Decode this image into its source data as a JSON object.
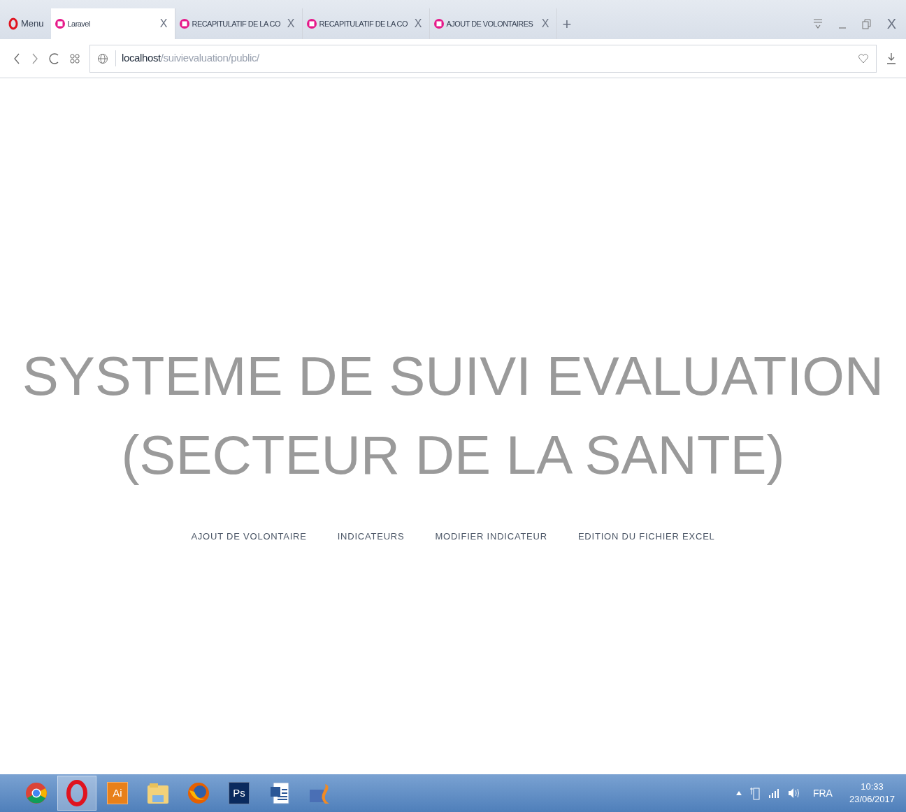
{
  "browser": {
    "menu_label": "Menu",
    "tabs": [
      {
        "label": "Laravel",
        "selected": true,
        "close": "X"
      },
      {
        "label": "RECAPITULATIF DE LA CO",
        "selected": false,
        "close": "X"
      },
      {
        "label": "RECAPITULATIF DE LA CO",
        "selected": false,
        "close": "X"
      },
      {
        "label": "AJOUT DE VOLONTAIRES",
        "selected": false,
        "close": "X"
      }
    ],
    "new_tab_glyph": "+",
    "window_close_glyph": "X",
    "address": {
      "host": "localhost",
      "path": "/suivievaluation/public/"
    }
  },
  "page": {
    "title_lines": [
      "SYSTEME DE SUIVI EVALUATION",
      "(SECTEUR DE LA SANTE)"
    ],
    "links": [
      "AJOUT DE VOLONTAIRE",
      "INDICATEURS",
      "MODIFIER INDICATEUR",
      "EDITION DU FICHIER EXCEL"
    ]
  },
  "taskbar": {
    "apps": [
      {
        "kind": "chrome",
        "selected": false
      },
      {
        "kind": "opera",
        "selected": true
      },
      {
        "kind": "lettered",
        "label": "Ai",
        "color": "#e8801a",
        "selected": false
      },
      {
        "kind": "folder",
        "selected": false
      },
      {
        "kind": "firefox",
        "selected": false
      },
      {
        "kind": "lettered",
        "label": "Ps",
        "color": "#0a2a5e",
        "selected": false
      },
      {
        "kind": "word",
        "selected": false
      },
      {
        "kind": "php",
        "selected": false
      }
    ],
    "language": "FRA",
    "time": "10:33",
    "date": "23/06/2017"
  }
}
